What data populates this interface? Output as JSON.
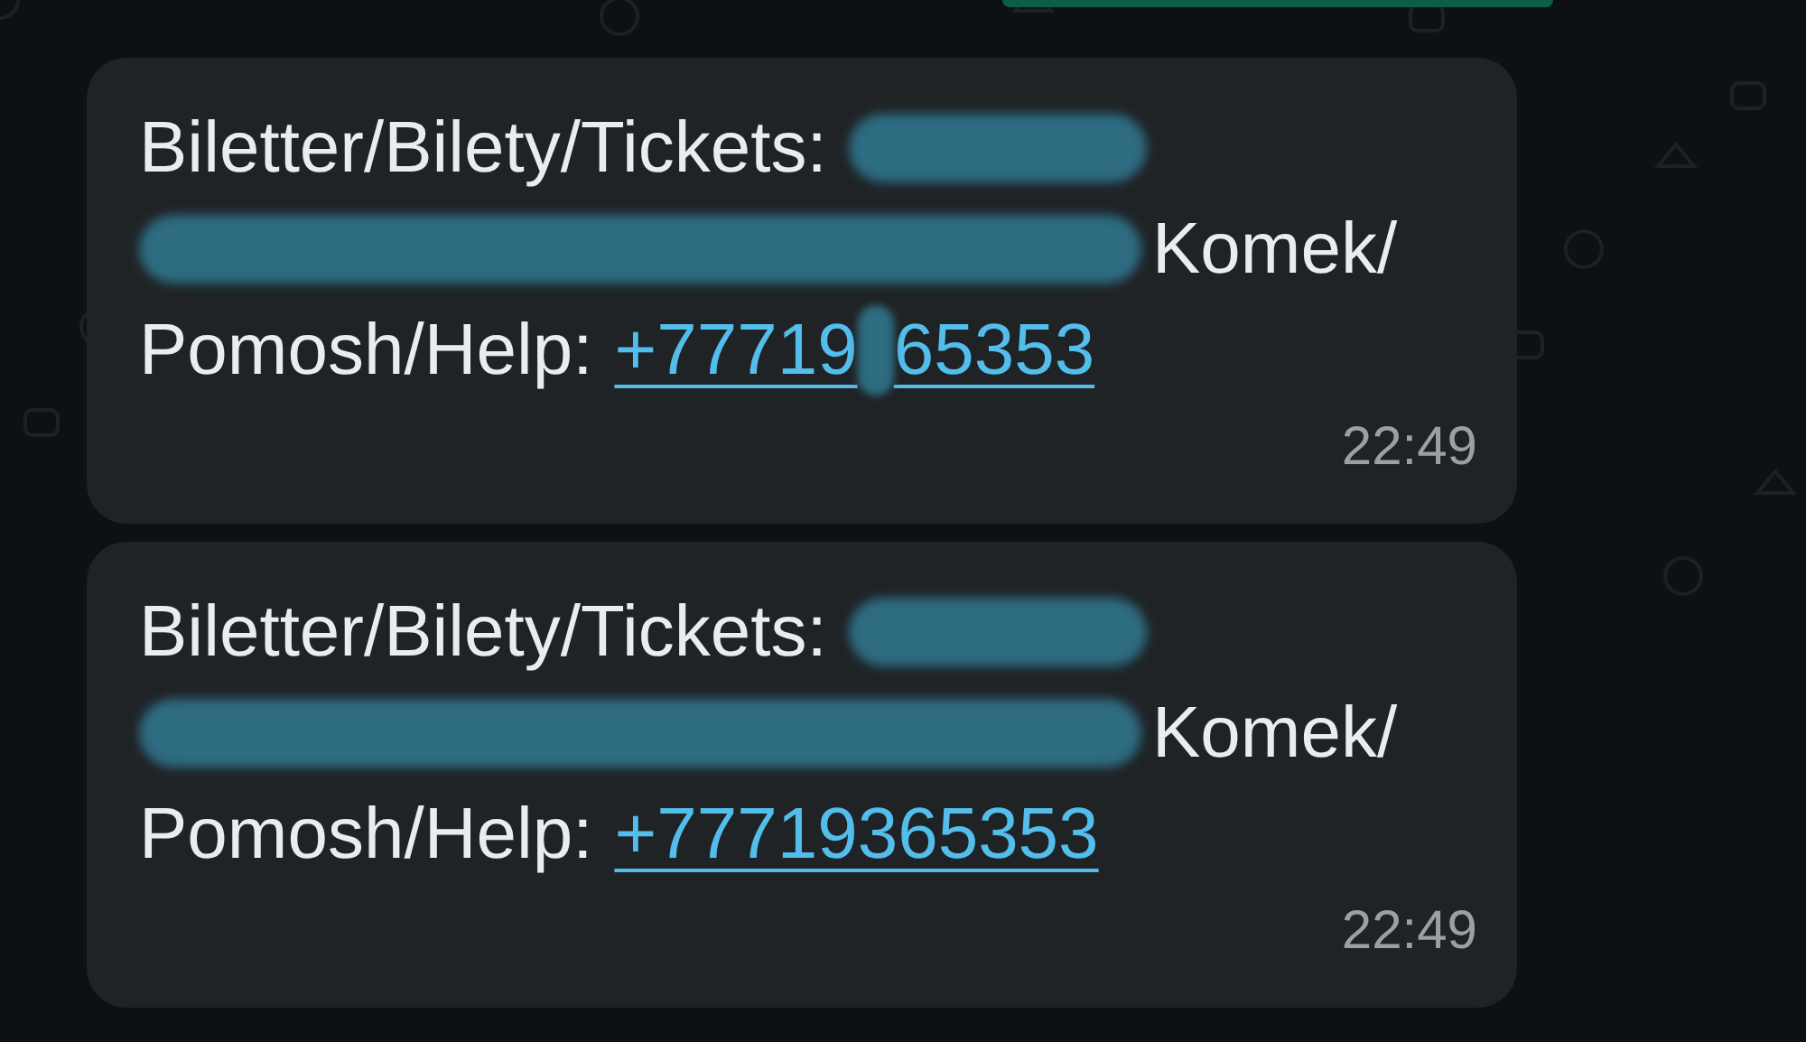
{
  "messages": [
    {
      "text_1": "Biletter/Bilety/Tickets:",
      "text_2": "Komek/",
      "text_3": "Pomosh/Help:",
      "phone_parts": [
        "+77719",
        "65353"
      ],
      "time": "22:49"
    },
    {
      "text_1": "Biletter/Bilety/Tickets:",
      "text_2": "Komek/",
      "text_3": "Pomosh/Help:",
      "phone_parts": [
        "+77719365353"
      ],
      "time": "22:49"
    }
  ]
}
